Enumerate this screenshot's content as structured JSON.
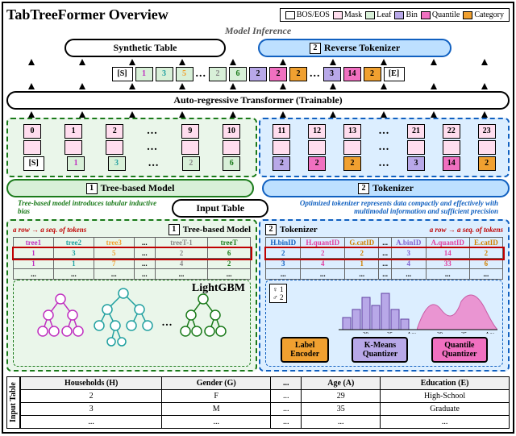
{
  "title": "TabTreeFormer Overview",
  "legend": {
    "bos": "BOS/EOS",
    "mask": "Mask",
    "leaf": "Leaf",
    "bin": "Bin",
    "quant": "Quantile",
    "cat": "Category"
  },
  "top": {
    "inference": "Model Inference",
    "synthetic_table": "Synthetic Table",
    "reverse_tokenizer": "Reverse Tokenizer",
    "num2": "2"
  },
  "tokens_out": {
    "s": "[S]",
    "e": "[E]",
    "leaf": [
      "1",
      "3",
      "5",
      "2",
      "6"
    ],
    "bin": "2",
    "quant": "2",
    "cat": "2",
    "binA": "3",
    "quantA": "14",
    "catE": "2",
    "dots": "..."
  },
  "transformer": "Auto-regressive Transformer (Trainable)",
  "positions": {
    "left": [
      "0",
      "1",
      "2",
      "9",
      "10"
    ],
    "right": [
      "11",
      "12",
      "13",
      "21",
      "22",
      "23"
    ]
  },
  "mid": {
    "tree_model": "Tree-based Model",
    "tokenizer": "Tokenizer",
    "num1": "1",
    "num2": "2",
    "input_table": "Input Table",
    "tree_caption": "Tree-based model introduces tabular inductive bias",
    "tok_caption": "Optimized tokenizer represents data compactly and effectively with multimodal information and sufficient precision"
  },
  "detail": {
    "row_caption": "a row → a seq. of tokens",
    "tree_section": "Tree-based Model",
    "tok_section": "Tokenizer",
    "tree_headers": [
      "tree1",
      "tree2",
      "tree3",
      "...",
      "treeT-1",
      "treeT"
    ],
    "tree_rows": [
      [
        "1",
        "3",
        "5",
        "...",
        "2",
        "6"
      ],
      [
        "1",
        "1",
        "7",
        "...",
        "4",
        "2"
      ],
      [
        "...",
        "...",
        "...",
        "...",
        "...",
        "..."
      ]
    ],
    "tok_headers": [
      "H.binID",
      "H.quantID",
      "G.catID",
      "...",
      "A.binID",
      "A.quantID",
      "E.catID"
    ],
    "tok_rows": [
      [
        "2",
        "2",
        "2",
        "...",
        "3",
        "14",
        "2"
      ],
      [
        "3",
        "4",
        "1",
        "...",
        "4",
        "33",
        "6"
      ],
      [
        "...",
        "...",
        "...",
        "...",
        "...",
        "...",
        "..."
      ]
    ],
    "lightgbm": "LightGBM",
    "label_encoder": "Label Encoder",
    "kmeans": "K-Means Quantizer",
    "quantile": "Quantile Quantizer",
    "gender": {
      "f": "♀ 1",
      "m": "♂ 2"
    },
    "age_ticks": [
      "29",
      "35",
      "Age"
    ]
  },
  "input_table": {
    "label": "Input Table",
    "headers": [
      "Households (H)",
      "Gender (G)",
      "...",
      "Age (A)",
      "Education (E)"
    ],
    "rows": [
      [
        "2",
        "F",
        "...",
        "29",
        "High-School"
      ],
      [
        "3",
        "M",
        "...",
        "35",
        "Graduate"
      ],
      [
        "...",
        "...",
        "...",
        "...",
        "..."
      ]
    ]
  }
}
